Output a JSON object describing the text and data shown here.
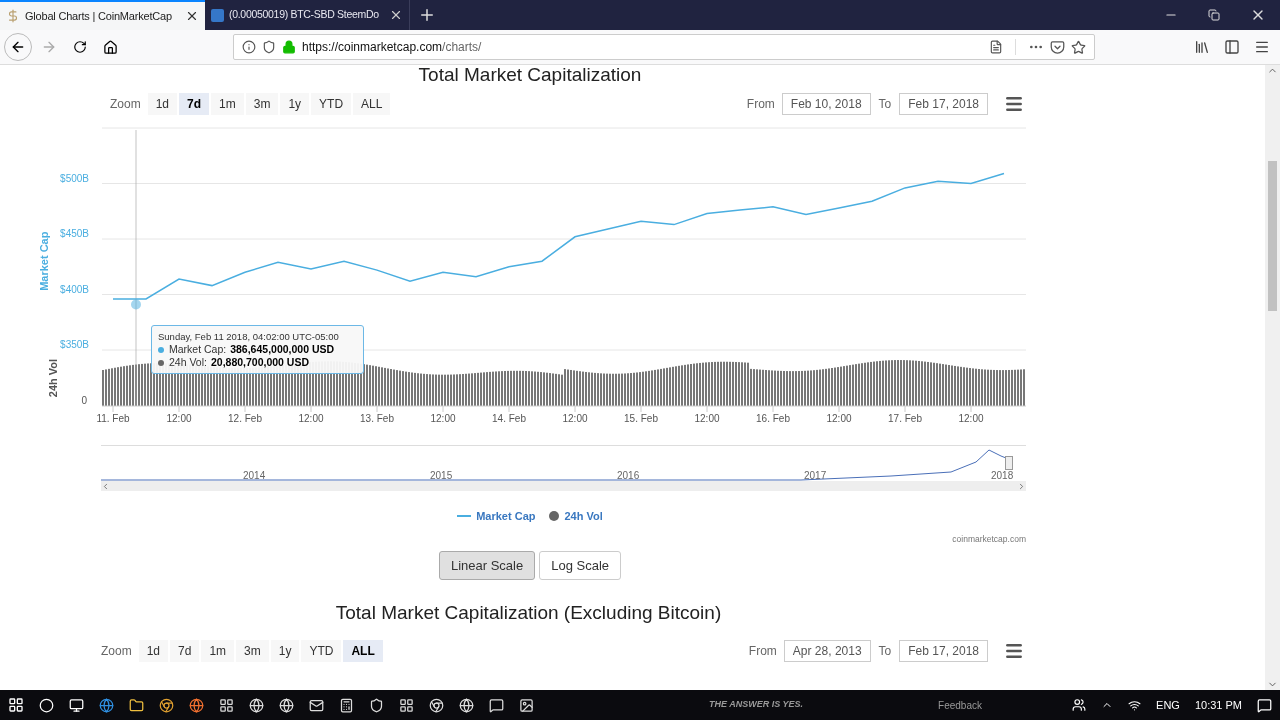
{
  "browser": {
    "tabs": [
      {
        "title": "Global Charts | CoinMarketCap",
        "selected": true
      },
      {
        "title": "(0.00050019) BTC-SBD SteemDo",
        "selected": false
      }
    ],
    "url_host": "https://coinmarketcap.com",
    "url_path": "/charts/"
  },
  "page": {
    "title_top": "Total Market Capitalization",
    "zoom": {
      "label": "Zoom",
      "options": [
        {
          "label": "1d",
          "selected": false
        },
        {
          "label": "7d",
          "selected": true
        },
        {
          "label": "1m",
          "selected": false
        },
        {
          "label": "3m",
          "selected": false
        },
        {
          "label": "1y",
          "selected": false
        },
        {
          "label": "YTD",
          "selected": false
        },
        {
          "label": "ALL",
          "selected": false
        }
      ]
    },
    "from_label": "From",
    "from": "Feb 10, 2018",
    "to_label": "To",
    "to": "Feb 17, 2018",
    "chart_data": {
      "type": "line",
      "ylabel": "Market Cap",
      "ylim": [
        350,
        550
      ],
      "grid": true,
      "categories": [
        "11. Feb",
        null,
        "12:00",
        null,
        "12. Feb",
        null,
        "12:00",
        null,
        "13. Feb",
        null,
        "12:00",
        null,
        "14. Feb",
        null,
        "12:00",
        null,
        "15. Feb",
        null,
        "12:00",
        null,
        "16. Feb",
        null,
        "12:00",
        null,
        "17. Feb",
        null,
        "12:00",
        null
      ],
      "yticks": [
        {
          "value": 350,
          "label": "$350B"
        },
        {
          "value": 400,
          "label": "$400B"
        },
        {
          "value": 450,
          "label": "$450B"
        },
        {
          "value": 500,
          "label": "$500B"
        }
      ],
      "series": [
        {
          "name": "Market Cap",
          "color": "#4aaee0",
          "values": [
            396,
            396,
            414,
            408,
            420,
            429,
            423,
            430,
            422,
            412,
            420,
            416,
            425,
            430,
            452,
            459,
            466,
            463,
            473,
            476,
            479,
            472,
            478,
            484,
            496,
            502,
            500,
            509
          ]
        }
      ]
    },
    "vol_label": "24h Vol",
    "vol_zero": "0",
    "tooltip": {
      "date": "Sunday, Feb 11 2018, 04:02:00 UTC-05:00",
      "rows": [
        {
          "label": "Market Cap:",
          "value": "386,645,000,000 USD",
          "color": "#4aaee0"
        },
        {
          "label": "24h Vol:",
          "value": "20,880,700,000 USD",
          "color": "#666666"
        }
      ]
    },
    "navigator_years": [
      "2014",
      "2015",
      "2016",
      "2017",
      "2018"
    ],
    "legend": [
      {
        "kind": "line",
        "color": "#4aaee0"
      },
      {
        "kind": "dot",
        "label": "24h Vol",
        "color": "#666666"
      }
    ],
    "credit": "coinmarketcap.com",
    "scales": [
      {
        "label": "Linear Scale",
        "selected": true
      },
      {
        "label": "Log Scale",
        "selected": false
      }
    ],
    "title2": "Total Market Capitalization (Excluding Bitcoin)",
    "zoom2": {
      "label": "Zoom",
      "options": [
        {
          "label": "1d",
          "selected": false
        },
        {
          "label": "7d",
          "selected": false
        },
        {
          "label": "1m",
          "selected": false
        },
        {
          "label": "3m",
          "selected": false
        },
        {
          "label": "1y",
          "selected": false
        },
        {
          "label": "YTD",
          "selected": false
        },
        {
          "label": "ALL",
          "selected": true
        }
      ]
    },
    "from_label2": "From",
    "from2": "Apr 28, 2013",
    "to_label2": "To",
    "to2": "Feb 17, 2018"
  },
  "taskbar": {
    "wallpaper_text": "THE ANSWER IS YES.",
    "feedback": "Feedback",
    "lang": "ENG",
    "time": "10:31 PM"
  }
}
